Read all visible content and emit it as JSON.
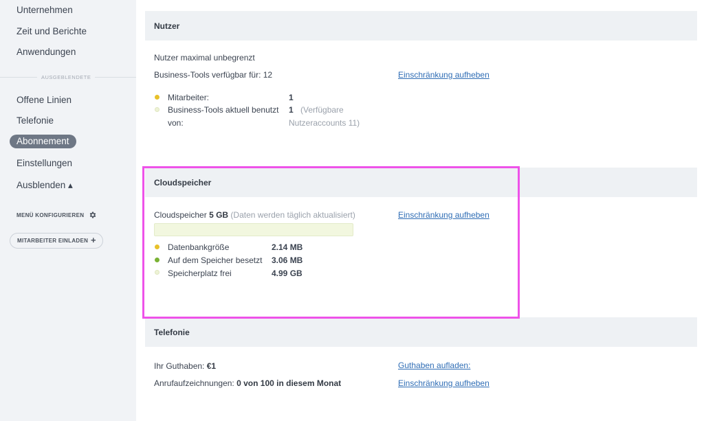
{
  "sidebar": {
    "items_top": [
      "Unternehmen",
      "Zeit und Berichte",
      "Anwendungen"
    ],
    "hidden_label": "AUSGEBLENDETE",
    "items_hidden": [
      "Offene Linien",
      "Telefonie",
      "Abonnement",
      "Einstellungen",
      "Ausblenden ▴"
    ],
    "menu_configure": "MENÜ KONFIGURIEREN",
    "invite_button": "MITARBEITER EINLADEN"
  },
  "users": {
    "title": "Nutzer",
    "max_users": "Nutzer maximal unbegrenzt",
    "available_for": "Business-Tools verfügbar für: 12",
    "remove_limit": "Einschränkung aufheben",
    "employees_label": "Mitarbeiter:",
    "employees_value": "1",
    "tools_used_label_1": "Business-Tools aktuell benutzt",
    "tools_used_label_2": "von:",
    "tools_used_value": "1",
    "tools_used_note_1": "(Verfügbare",
    "tools_used_note_2": "Nutzeraccounts 11)"
  },
  "storage": {
    "title": "Cloudspeicher",
    "label": "Cloudspeicher",
    "size": "5 GB",
    "note": "(Daten werden täglich aktualisiert)",
    "remove_limit": "Einschränkung aufheben",
    "rows": [
      {
        "label": "Datenbankgröße",
        "value": "2.14 MB",
        "color": "#e8c12a"
      },
      {
        "label": "Auf dem Speicher besetzt",
        "value": "3.06 MB",
        "color": "#7ab234"
      },
      {
        "label": "Speicherplatz frei",
        "value": "4.99 GB",
        "color": "#eef3d6"
      }
    ]
  },
  "telephony": {
    "title": "Telefonie",
    "balance_label": "Ihr Guthaben:",
    "balance_value": "€1",
    "top_up": "Guthaben aufladen:",
    "recordings_label": "Anrufaufzeichnungen:",
    "recordings_value": "0 von 100 in diesem Monat",
    "remove_limit": "Einschränkung aufheben"
  },
  "colors": {
    "highlight": "#ee52e9",
    "link": "#2f6db5",
    "employees_dot": "#e8c12a",
    "tools_dot": "#eef3d6"
  }
}
